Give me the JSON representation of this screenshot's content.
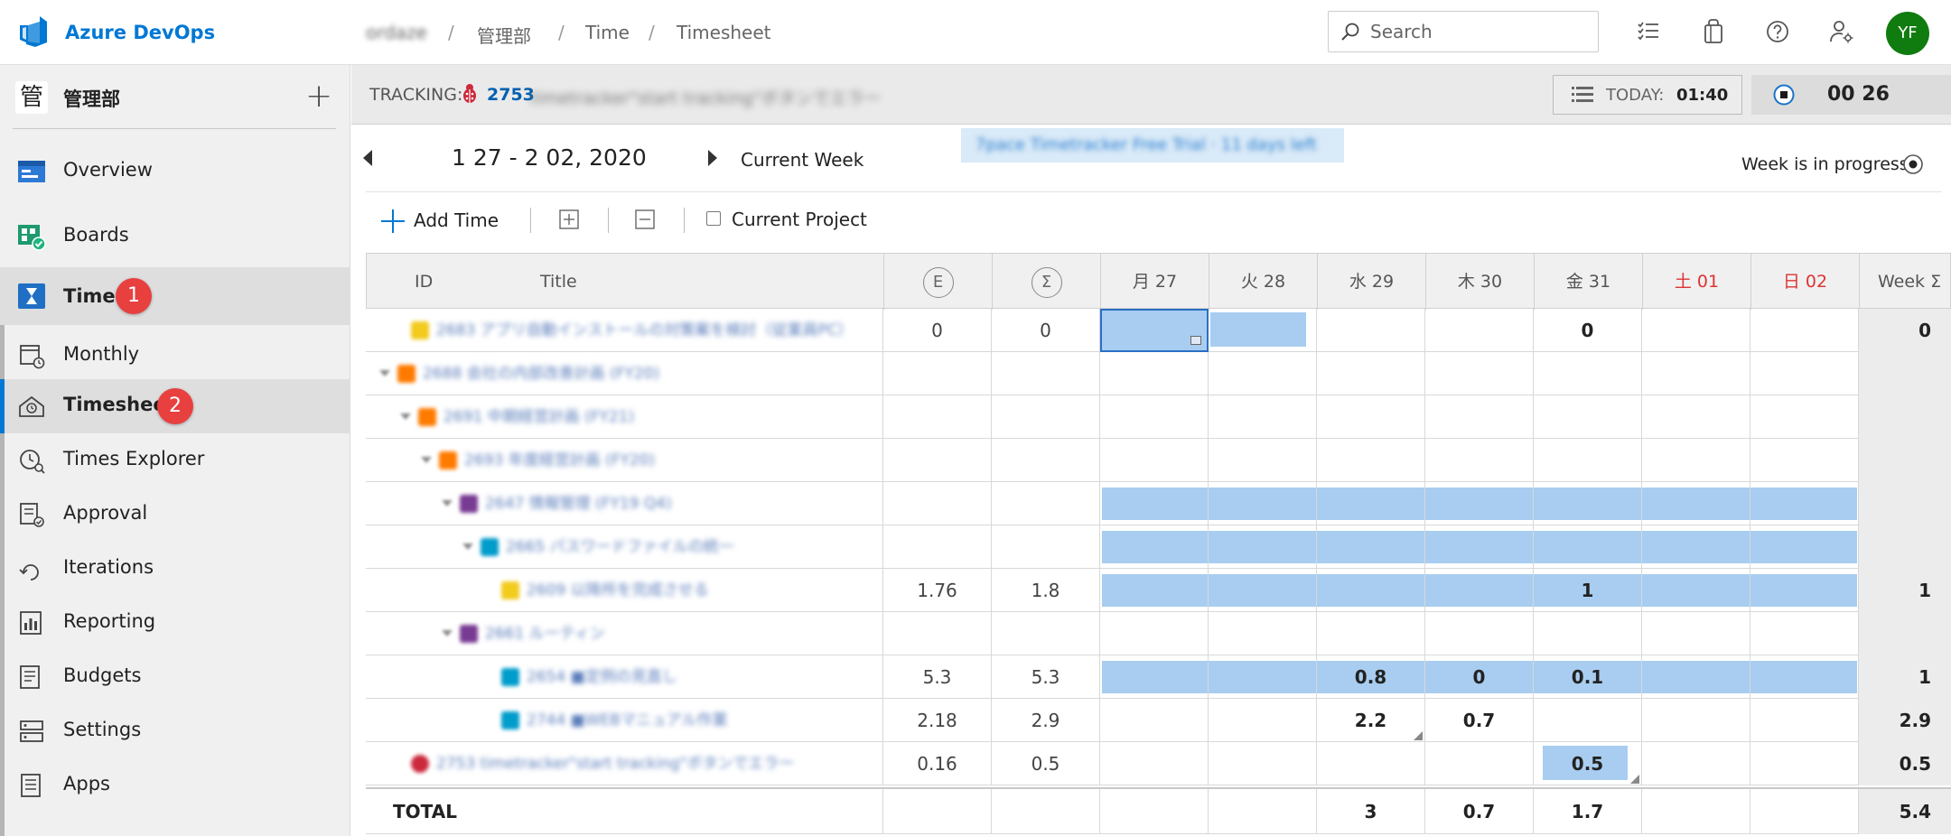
{
  "topbar": {
    "brand": "Azure DevOps",
    "org": "ordaze",
    "breadcrumbs": [
      "管理部",
      "Time",
      "Timesheet"
    ],
    "search_placeholder": "Search",
    "avatar_initials": "YF",
    "avatar_color": "#107c10"
  },
  "sidebar": {
    "project_icon_char": "管",
    "project_name": "管理部",
    "add_label": "+",
    "items": [
      {
        "label": "Overview",
        "icon": "overview-icon"
      },
      {
        "label": "Boards",
        "icon": "boards-icon"
      },
      {
        "label": "Time",
        "icon": "time-hourglass-icon",
        "badge": "1"
      },
      {
        "label": "Monthly",
        "icon": "calendar-icon"
      },
      {
        "label": "Timesheet",
        "icon": "timesheet-icon",
        "badge": "2"
      },
      {
        "label": "Times Explorer",
        "icon": "times-explorer-icon"
      },
      {
        "label": "Approval",
        "icon": "approval-icon"
      },
      {
        "label": "Iterations",
        "icon": "iterations-icon"
      },
      {
        "label": "Reporting",
        "icon": "reporting-icon"
      },
      {
        "label": "Budgets",
        "icon": "budgets-icon"
      },
      {
        "label": "Settings",
        "icon": "settings-icon"
      },
      {
        "label": "Apps",
        "icon": "apps-icon"
      }
    ]
  },
  "tracking": {
    "label": "TRACKING:",
    "item_id": "2753",
    "item_title": "timetracker\"start tracking\"ボタンでエラー",
    "today_label": "TODAY:",
    "today_value": "01:40",
    "timer_value": "00 26"
  },
  "week": {
    "range": "1 27 - 2 02, 2020",
    "current_label": "Current Week",
    "trial_text": "7pace Timetracker Free Trial · 11 days left",
    "status": "Week is in progress"
  },
  "toolbar": {
    "add_time": "Add Time",
    "current_project": "Current Project"
  },
  "grid": {
    "headers": {
      "id": "ID",
      "title": "Title",
      "estimate": "E",
      "sum": "Σ",
      "days": [
        "月 27",
        "火 28",
        "水 29",
        "木 30",
        "金 31",
        "土 01",
        "日 02"
      ],
      "week": "Week Σ"
    },
    "rows": [
      {
        "id": "2683",
        "title": "アプリ自動インストールの対策案を検討（従業員PC）",
        "e": "0",
        "s": "0",
        "days": [
          "",
          "",
          "",
          "",
          "0",
          "",
          ""
        ],
        "week": "0",
        "icon": "user-story-icon"
      },
      {
        "id": "2688",
        "title": "会社の内部改善計画 (FY20)",
        "e": "",
        "s": "",
        "days": [
          "",
          "",
          "",
          "",
          "",
          "",
          ""
        ],
        "week": "",
        "icon": "epic-icon"
      },
      {
        "id": "2691",
        "title": "中期経営計画 (FY21)",
        "e": "",
        "s": "",
        "days": [
          "",
          "",
          "",
          "",
          "",
          "",
          ""
        ],
        "week": "",
        "icon": "epic-icon"
      },
      {
        "id": "2693",
        "title": "年度経営計画 (FY20)",
        "e": "",
        "s": "",
        "days": [
          "",
          "",
          "",
          "",
          "",
          "",
          ""
        ],
        "week": "",
        "icon": "epic-icon"
      },
      {
        "id": "2647",
        "title": "情報管理 (FY19 Q4)",
        "e": "",
        "s": "",
        "days": [
          "",
          "",
          "",
          "",
          "",
          "",
          ""
        ],
        "week": "",
        "icon": "feature-icon"
      },
      {
        "id": "2665",
        "title": "パスワードファイルの統一",
        "e": "",
        "s": "",
        "days": [
          "",
          "",
          "",
          "",
          "",
          "",
          ""
        ],
        "week": "",
        "icon": "task-group-icon"
      },
      {
        "id": "2609",
        "title": "以降所を完成させる",
        "e": "1.76",
        "s": "1.8",
        "days": [
          "",
          "",
          "",
          "",
          "1",
          "",
          ""
        ],
        "week": "1",
        "icon": "user-story-icon"
      },
      {
        "id": "2661",
        "title": "ルーティン",
        "e": "",
        "s": "",
        "days": [
          "",
          "",
          "",
          "",
          "",
          "",
          ""
        ],
        "week": "",
        "icon": "feature-icon"
      },
      {
        "id": "2654",
        "title": "■定例の見直し",
        "e": "5.3",
        "s": "5.3",
        "days": [
          "",
          "",
          "0.8",
          "0",
          "0.1",
          "",
          ""
        ],
        "week": "1",
        "icon": "task-icon"
      },
      {
        "id": "2744",
        "title": "■WEBマニュアル作業",
        "e": "2.18",
        "s": "2.9",
        "days": [
          "",
          "",
          "2.2",
          "0.7",
          "",
          "",
          ""
        ],
        "week": "2.9",
        "icon": "task-icon"
      },
      {
        "id": "2753",
        "title": "timetracker\"start tracking\"ボタンでエラー",
        "e": "0.16",
        "s": "0.5",
        "days": [
          "",
          "",
          "",
          "",
          "0.5",
          "",
          ""
        ],
        "week": "0.5",
        "icon": "bug-icon"
      }
    ],
    "total": {
      "label": "TOTAL",
      "days": [
        "",
        "",
        "3",
        "0.7",
        "1.7",
        "",
        ""
      ],
      "week": "5.4"
    }
  },
  "colors": {
    "accent": "#0078d4",
    "badge": "#e83f3f",
    "highlight": "#a8cdf0",
    "weekend": "#d33333"
  }
}
